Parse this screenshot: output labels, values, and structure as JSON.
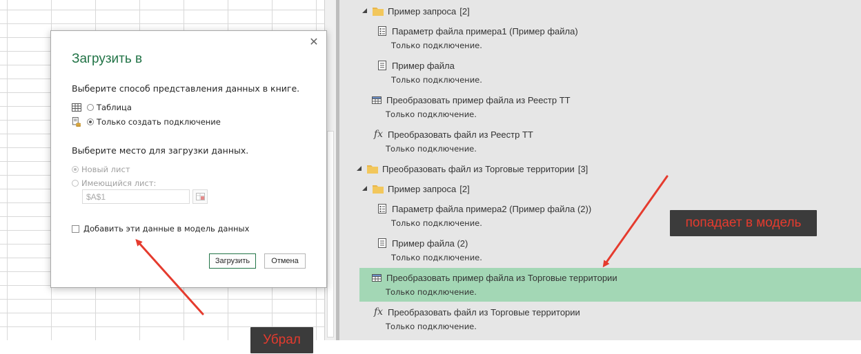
{
  "dialog": {
    "title": "Загрузить в",
    "close_glyph": "✕",
    "view_prompt": "Выберите способ представления данных в книге.",
    "view_options": [
      {
        "label": "Таблица",
        "selected": false,
        "icon": "table-icon"
      },
      {
        "label": "Только создать подключение",
        "selected": true,
        "icon": "connection-icon"
      }
    ],
    "location_prompt": "Выберите место для загрузки данных.",
    "location_options": [
      {
        "label": "Новый лист",
        "selected": true
      },
      {
        "label": "Имеющийся лист:",
        "selected": false
      }
    ],
    "cell_reference": "$A$1",
    "add_to_model_label": "Добавить эти данные в модель данных",
    "add_to_model_checked": false,
    "load_button": "Загрузить",
    "cancel_button": "Отмена"
  },
  "queries": {
    "items": [
      {
        "kind": "group",
        "name": "Пример запроса",
        "count": "[2]"
      },
      {
        "kind": "parameter",
        "name": "Параметр файла примера1 (Пример файла)",
        "status": "Только подключение."
      },
      {
        "kind": "file",
        "name": "Пример файла",
        "status": "Только подключение."
      },
      {
        "kind": "table",
        "name": "Преобразовать пример файла из Реестр ТТ",
        "status": "Только подключение."
      },
      {
        "kind": "function",
        "name": "Преобразовать файл из Реестр ТТ",
        "status": "Только подключение."
      },
      {
        "kind": "group",
        "name": "Преобразовать файл из Торговые территории",
        "count": "[3]"
      },
      {
        "kind": "group",
        "name": "Пример запроса",
        "count": "[2]"
      },
      {
        "kind": "parameter",
        "name": "Параметр файла примера2 (Пример файла (2))",
        "status": "Только подключение."
      },
      {
        "kind": "file",
        "name": "Пример файла (2)",
        "status": "Только подключение."
      },
      {
        "kind": "table",
        "name": "Преобразовать пример файла из Торговые территории",
        "status": "Только подключение.",
        "highlighted": true
      },
      {
        "kind": "function",
        "name": "Преобразовать файл из Торговые территории",
        "status": "Только подключение."
      }
    ]
  },
  "annotations": {
    "removed_label": "Убрал",
    "to_model_label": "попадает в модель",
    "color": "#e53b2e"
  },
  "colors": {
    "accent": "#217346",
    "highlight": "#a3d7b5",
    "pane_bg": "#e6e6e6"
  }
}
